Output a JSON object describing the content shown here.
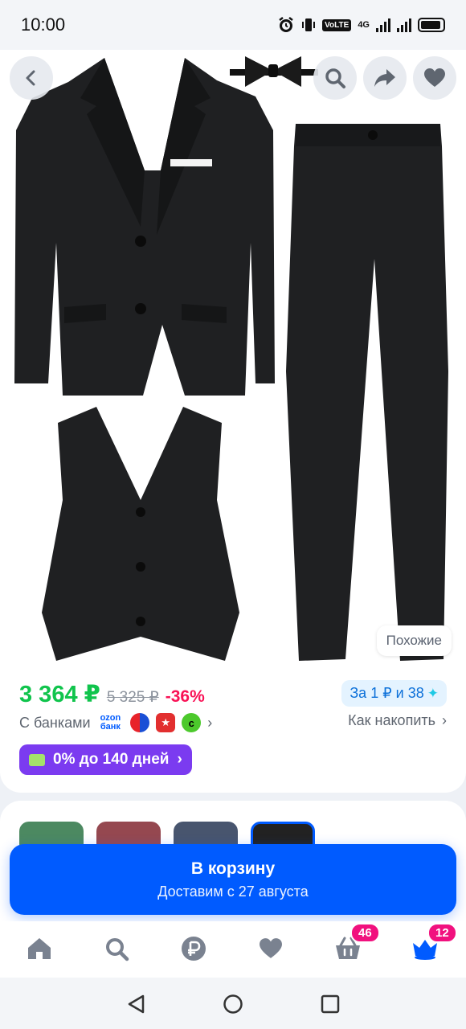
{
  "status_bar": {
    "time": "10:00",
    "volte": "VoLTE",
    "network": "4G"
  },
  "gallery": {
    "similar_label": "Похожие",
    "icons": [
      "back-icon",
      "search-icon",
      "share-icon",
      "heart-icon"
    ]
  },
  "pricing": {
    "price": "3 364 ₽",
    "old_price": "5 325 ₽",
    "discount": "-36%",
    "points": "За 1 ₽ и 38",
    "banks_label": "С банками",
    "ozon_bank_line1": "ozon",
    "ozon_bank_line2": "банк",
    "accumulate": "Как накопить",
    "installment": "0% до 140 дней"
  },
  "variants": {
    "colors": [
      "#1f6b3a",
      "#7a1a24",
      "#1a2a4a",
      "#222222"
    ],
    "selected_index": 3
  },
  "cart": {
    "title": "В корзину",
    "subtitle": "Доставим с 27 августа"
  },
  "bottom_nav": {
    "items": [
      "home-icon",
      "search-icon",
      "ruble-icon",
      "heart-icon",
      "basket-icon",
      "profile-icon"
    ],
    "basket_badge": "46",
    "profile_badge": "12",
    "accent": "#005bff",
    "badge_color": "#f1117e"
  }
}
